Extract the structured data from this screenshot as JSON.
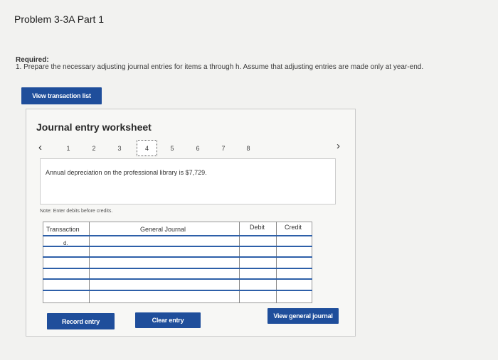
{
  "page": {
    "title": "Problem 3-3A Part 1",
    "required_label": "Required:",
    "required_text": "1. Prepare the necessary adjusting journal entries for items a through h. Assume that adjusting entries are made only at year-end."
  },
  "buttons": {
    "view_transactions": "View transaction list",
    "record_entry": "Record entry",
    "clear_entry": "Clear entry",
    "view_general_journal": "View general journal"
  },
  "worksheet": {
    "title": "Journal entry worksheet",
    "prev_icon": "‹",
    "next_icon": "›",
    "pages": [
      "1",
      "2",
      "3",
      "4",
      "5",
      "6",
      "7",
      "8"
    ],
    "active_page": "4",
    "description": "Annual depreciation on the professional library is $7,729.",
    "note": "Note: Enter debits before credits."
  },
  "table": {
    "headers": {
      "transaction": "Transaction",
      "general_journal": "General Journal",
      "debit": "Debit",
      "credit": "Credit"
    },
    "rows": [
      {
        "transaction": "d."
      },
      {
        "transaction": ""
      },
      {
        "transaction": ""
      },
      {
        "transaction": ""
      },
      {
        "transaction": ""
      },
      {
        "transaction": ""
      }
    ]
  },
  "colors": {
    "button_bg": "#1f4e9b",
    "accent_line": "#2d5fa8",
    "page_bg": "#f2f2f0"
  }
}
